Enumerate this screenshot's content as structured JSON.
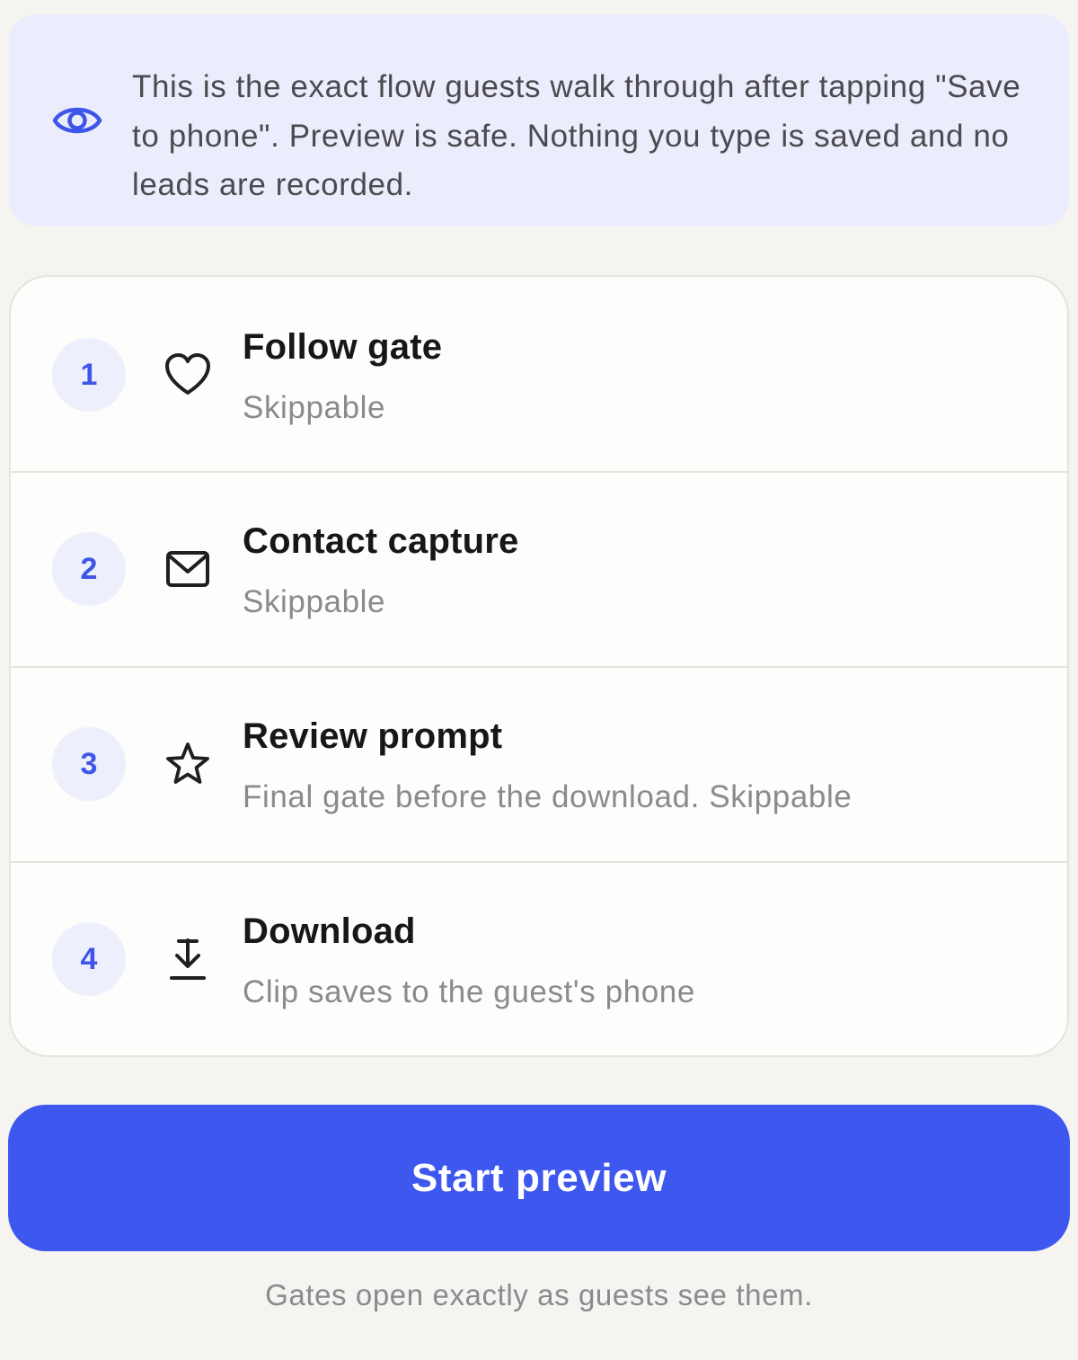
{
  "info_banner": {
    "icon": "eye-icon",
    "text": "This is the exact flow guests walk through after tapping \"Save to phone\". Preview is safe. Nothing you type is saved and no leads are recorded."
  },
  "steps": [
    {
      "number": "1",
      "icon": "heart-icon",
      "title": "Follow gate",
      "description": "Skippable"
    },
    {
      "number": "2",
      "icon": "mail-icon",
      "title": "Contact capture",
      "description": "Skippable"
    },
    {
      "number": "3",
      "icon": "star-icon",
      "title": "Review prompt",
      "description": "Final gate before the download. Skippable"
    },
    {
      "number": "4",
      "icon": "download-icon",
      "title": "Download",
      "description": "Clip saves to the guest's phone"
    }
  ],
  "start_button": {
    "label": "Start preview"
  },
  "footer": {
    "note": "Gates open exactly as guests see them."
  },
  "colors": {
    "accent": "#3e57ee",
    "banner_bg": "#ecedfc",
    "card_bg": "#fdfdfb",
    "page_bg": "#f5f4f1"
  }
}
